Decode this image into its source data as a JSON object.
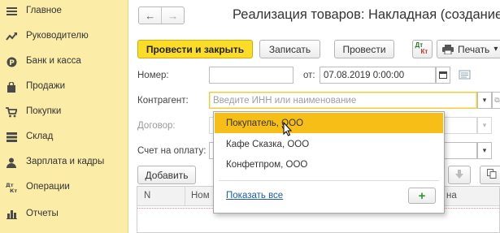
{
  "sidebar": {
    "items": [
      {
        "label": "Главное",
        "icon": "menu-lines-icon"
      },
      {
        "label": "Руководителю",
        "icon": "trend-chart-icon"
      },
      {
        "label": "Банк и касса",
        "icon": "coin-icon"
      },
      {
        "label": "Продажи",
        "icon": "shopping-bag-icon"
      },
      {
        "label": "Покупки",
        "icon": "shopping-cart-icon"
      },
      {
        "label": "Склад",
        "icon": "warehouse-icon"
      },
      {
        "label": "Зарплата и кадры",
        "icon": "person-icon"
      },
      {
        "label": "Операции",
        "icon": "debit-credit-icon"
      },
      {
        "label": "Отчеты",
        "icon": "bar-chart-icon"
      }
    ]
  },
  "header": {
    "back": "←",
    "forward": "→",
    "title": "Реализация товаров: Накладная (создание"
  },
  "toolbar": {
    "post_and_close": "Провести и закрыть",
    "save": "Записать",
    "post": "Провести",
    "dtkt_top": "Дт",
    "dtkt_bottom": "Кт",
    "print": "Печать",
    "print_arrow": "▾"
  },
  "form": {
    "number_label": "Номер:",
    "number_value": "",
    "date_label": "от:",
    "date_value": "07.08.2019  0:00:00",
    "counterparty_label": "Контрагент:",
    "counterparty_placeholder": "Введите ИНН или наименование",
    "contract_label": "Договор:",
    "invoice_label": "Счет на оплату:",
    "dropdown_arrow": "▾"
  },
  "table": {
    "add_button": "Добавить",
    "columns": [
      "N",
      "Ном",
      "на"
    ]
  },
  "dropdown": {
    "items": [
      "Покупатель, ООО",
      "Кафе Сказка, ООО",
      "Конфетпром, ООО"
    ],
    "selected_index": 0,
    "show_all": "Показать все",
    "add_symbol": "+"
  },
  "colors": {
    "sidebar_bg": "#fbeca8",
    "primary_button": "#fbdc26",
    "selected_item": "#f6be16",
    "link": "#1d5ea8",
    "add_icon": "#2b9b3a"
  }
}
